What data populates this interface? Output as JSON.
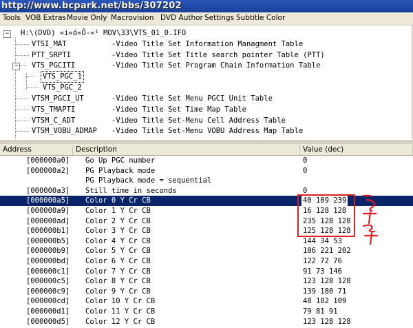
{
  "watermark": "http://www.bcpark.net/bbs/307202",
  "menu": [
    "Tools",
    "VOB Extras",
    "Movie Only",
    "Macrovision",
    "DVD Author",
    "Settings",
    "Subtitle Color"
  ],
  "tree": {
    "root": "H:\\(DVD) «i«ó«Ô-«¹ MOV\\33\\VTS_01_0.IFO",
    "nodes": [
      {
        "label": "VTSI_MAT",
        "desc": "-Video Title Set Information Managment Table"
      },
      {
        "label": "PTT_SRPTI",
        "desc": "-Video Title Set Title search pointer Table (PTT)"
      },
      {
        "label": "VTS_PGCITI",
        "desc": "-Video Title Set Program Chain Information Table"
      },
      {
        "label": "VTS_PGC_1",
        "desc": ""
      },
      {
        "label": "VTS_PGC_2",
        "desc": ""
      },
      {
        "label": "VTSM_PGCI_UT",
        "desc": "-Video Title Set Menu PGCI Unit Table"
      },
      {
        "label": "VTS_TMAPTI",
        "desc": "-Video Title Set Time Map Table"
      },
      {
        "label": "VTSM_C_ADT",
        "desc": "-Video Title Set-Menu Cell Address Table"
      },
      {
        "label": "VTSM_VOBU_ADMAP",
        "desc": "-Video Title Set-Menu VOBU Address Map Table"
      }
    ],
    "expander_minus": "−"
  },
  "columns": {
    "address": "Address",
    "description": "Description",
    "value": "Value (dec)"
  },
  "rows": [
    {
      "address": "[000000a0]",
      "description": "Go Up PGC number",
      "value": "0"
    },
    {
      "address": "[000000a2]",
      "description": "PG Playback mode",
      "value": "0"
    },
    {
      "address": "",
      "description": "  PG Playback mode = sequential",
      "value": ""
    },
    {
      "address": "[000000a3]",
      "description": "Still time in seconds",
      "value": "0"
    },
    {
      "address": "[000000a5]",
      "description": "Color 0 Y Cr CB",
      "value": "40 109 239"
    },
    {
      "address": "[000000a9]",
      "description": "Color 1 Y Cr CB",
      "value": "16 128 128"
    },
    {
      "address": "[000000ad]",
      "description": "Color 2 Y Cr CB",
      "value": "235 128 128"
    },
    {
      "address": "[000000b1]",
      "description": "Color 3 Y Cr CB",
      "value": "125 128 128"
    },
    {
      "address": "[000000b5]",
      "description": "Color 4 Y Cr CB",
      "value": "144 34 53"
    },
    {
      "address": "[000000b9]",
      "description": "Color 5 Y Cr CB",
      "value": "106 221 202"
    },
    {
      "address": "[000000bd]",
      "description": "Color 6 Y Cr CB",
      "value": "122 72 76"
    },
    {
      "address": "[000000c1]",
      "description": "Color 7 Y Cr CB",
      "value": "91 73 146"
    },
    {
      "address": "[000000c5]",
      "description": "Color 8 Y Cr CB",
      "value": "123 128 128"
    },
    {
      "address": "[000000c9]",
      "description": "Color 9 Y Cr CB",
      "value": "139 180 71"
    },
    {
      "address": "[000000cd]",
      "description": "Color 10 Y Cr CB",
      "value": "48 182 109"
    },
    {
      "address": "[000000d1]",
      "description": "Color 11 Y Cr CB",
      "value": "79 81 91"
    },
    {
      "address": "[000000d5]",
      "description": "Color 12 Y Cr CB",
      "value": "123 128 128"
    }
  ],
  "selected_row_index": 4,
  "colors": {
    "selection": "#0a246a",
    "annotation": "#e02020",
    "titlebar": "#1a3f9a"
  }
}
